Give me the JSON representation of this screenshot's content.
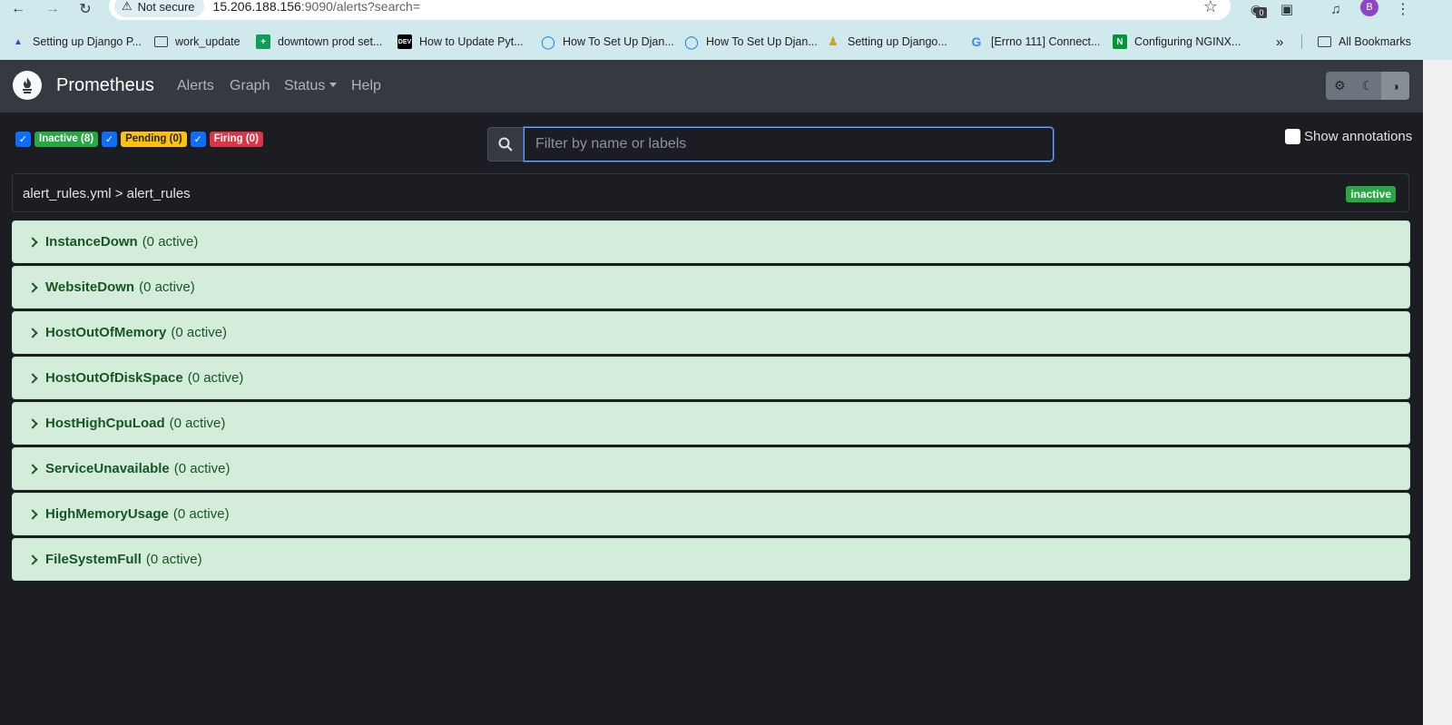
{
  "browser": {
    "secure_label": "Not secure",
    "url_host": "15.206.188.156",
    "url_rest": ":9090/alerts?search=",
    "extension_badge": "0",
    "profile_initial": "B",
    "bookmarks": [
      {
        "label": "Setting up Django P...",
        "icon": "django-favicon"
      },
      {
        "label": "work_update",
        "icon": "folder-icon"
      },
      {
        "label": "downtown prod set...",
        "icon": "sheets-icon"
      },
      {
        "label": "How to Update Pyt...",
        "icon": "dev-icon"
      },
      {
        "label": "How To Set Up Djan...",
        "icon": "digitalocean-icon"
      },
      {
        "label": "How To Set Up Djan...",
        "icon": "digitalocean-icon"
      },
      {
        "label": "Setting up Django...",
        "icon": "python-icon"
      },
      {
        "label": "[Errno 111] Connect...",
        "icon": "google-icon"
      },
      {
        "label": "Configuring NGINX...",
        "icon": "nginx-icon"
      }
    ],
    "more_bookmarks": "»",
    "all_bookmarks": "All Bookmarks"
  },
  "navbar": {
    "brand": "Prometheus",
    "links": [
      "Alerts",
      "Graph",
      "Status",
      "Help"
    ]
  },
  "filters": {
    "inactive": "Inactive (8)",
    "pending": "Pending (0)",
    "firing": "Firing (0)"
  },
  "search": {
    "placeholder": "Filter by name or labels",
    "value": ""
  },
  "show_annotations": "Show annotations",
  "group": {
    "title": "alert_rules.yml > alert_rules",
    "state": "inactive"
  },
  "rules": [
    {
      "name": "InstanceDown",
      "count": "(0 active)"
    },
    {
      "name": "WebsiteDown",
      "count": "(0 active)"
    },
    {
      "name": "HostOutOfMemory",
      "count": "(0 active)"
    },
    {
      "name": "HostOutOfDiskSpace",
      "count": "(0 active)"
    },
    {
      "name": "HostHighCpuLoad",
      "count": "(0 active)"
    },
    {
      "name": "ServiceUnavailable",
      "count": "(0 active)"
    },
    {
      "name": "HighMemoryUsage",
      "count": "(0 active)"
    },
    {
      "name": "FileSystemFull",
      "count": "(0 active)"
    }
  ],
  "colors": {
    "rule_bg": "#d4edda",
    "rule_text": "#155724",
    "inactive": "#28a745",
    "pending": "#ffc107",
    "firing": "#dc3545"
  }
}
